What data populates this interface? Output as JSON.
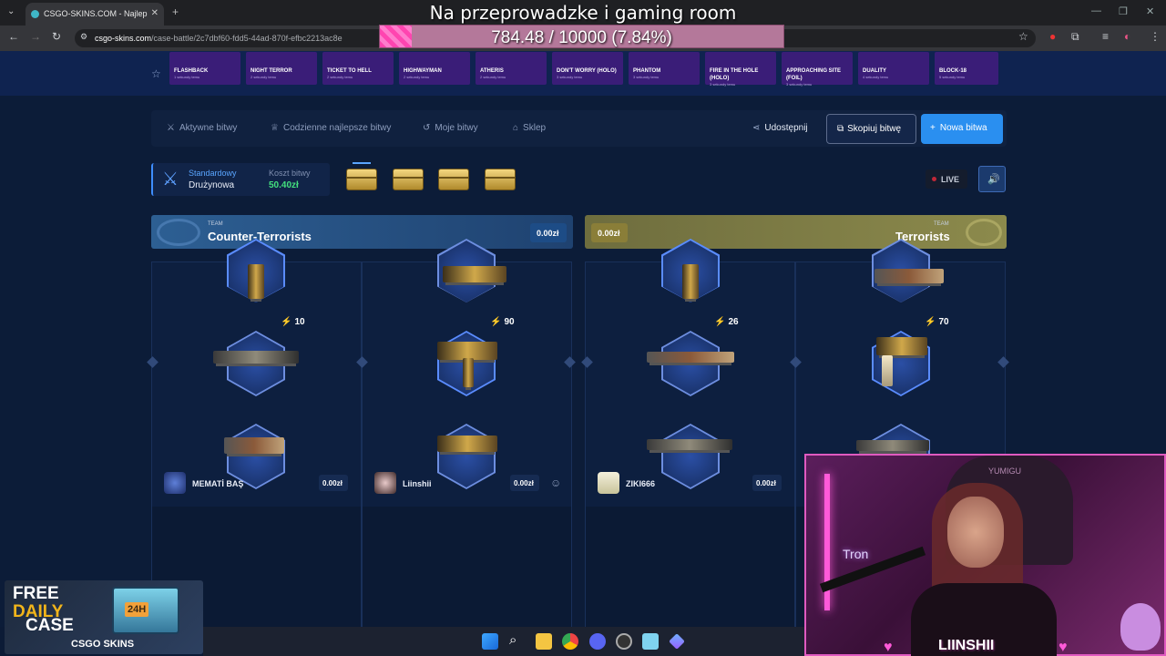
{
  "browser": {
    "tab_title": "CSGO-SKINS.COM - Najlep",
    "url_domain": "csgo-skins.com",
    "url_path": "/case-battle/2c7dbf60-fdd5-44ad-870f-efbc2213ac8e"
  },
  "stream_overlay": {
    "title": "Na przeprowadzke i gaming room",
    "goal_text": "784.48 / 10000 (7.84%)",
    "goal_fraction": 0.0784,
    "streamer_name": "LIINSHII",
    "cam_sign": "Tron",
    "chair_label": "YUMIGU"
  },
  "case_strip": [
    {
      "name": "FLASHBACK",
      "sub": "1 sekundy temu"
    },
    {
      "name": "NIGHT TERROR",
      "sub": "2 sekundy temu"
    },
    {
      "name": "TICKET TO HELL",
      "sub": "2 sekundy temu"
    },
    {
      "name": "HIGHWAYMAN",
      "sub": "2 sekundy temu"
    },
    {
      "name": "ATHERIS",
      "sub": "2 sekundy temu"
    },
    {
      "name": "DON'T WORRY (HOLO)",
      "sub": "3 sekundy temu"
    },
    {
      "name": "PHANTOM",
      "sub": "3 sekundy temu"
    },
    {
      "name": "FIRE IN THE HOLE (HOLO)",
      "sub": "3 sekundy temu"
    },
    {
      "name": "APPROACHING SITE (FOIL)",
      "sub": "3 sekundy temu"
    },
    {
      "name": "DUALITY",
      "sub": "4 sekundy temu"
    },
    {
      "name": "BLOCK-18",
      "sub": "5 sekundy temu"
    }
  ],
  "nav": {
    "active_battles": "Aktywne bitwy",
    "daily_best": "Codzienne najlepsze bitwy",
    "my_battles": "Moje bitwy",
    "shop": "Sklep",
    "share": "Udostępnij",
    "copy_battle": "Skopiuj bitwę",
    "new_battle": "Nowa bitwa"
  },
  "battle": {
    "mode": "Standardowy",
    "type": "Drużynowa",
    "cost_label": "Koszt bitwy",
    "cost_value": "50.40zł",
    "live_label": "LIVE"
  },
  "teams": [
    {
      "label": "TEAM",
      "name": "Counter-Terrorists",
      "value": "0.00zł"
    },
    {
      "label": "TEAM",
      "name": "Terrorists",
      "value": "0.00zł"
    }
  ],
  "columns": [
    {
      "count": "10"
    },
    {
      "count": "90"
    },
    {
      "count": "26"
    },
    {
      "count": "70"
    }
  ],
  "players": [
    {
      "name": "MEMATİ BAŞ",
      "value": "0.00zł"
    },
    {
      "name": "Liinshii",
      "value": "0.00zł"
    },
    {
      "name": "ZIKI666",
      "value": "0.00zł"
    }
  ],
  "promo": {
    "line1": "FREE",
    "line2": "DAILY",
    "line3": "CASE",
    "badge": "24H",
    "brand": "CSGO SKINS"
  },
  "colors": {
    "accent": "#2a8ff0",
    "cost_green": "#43e07e",
    "ct_team": "#2d5f93",
    "t_team": "#8c8a4c",
    "overlay_pink": "#ff45b0"
  }
}
